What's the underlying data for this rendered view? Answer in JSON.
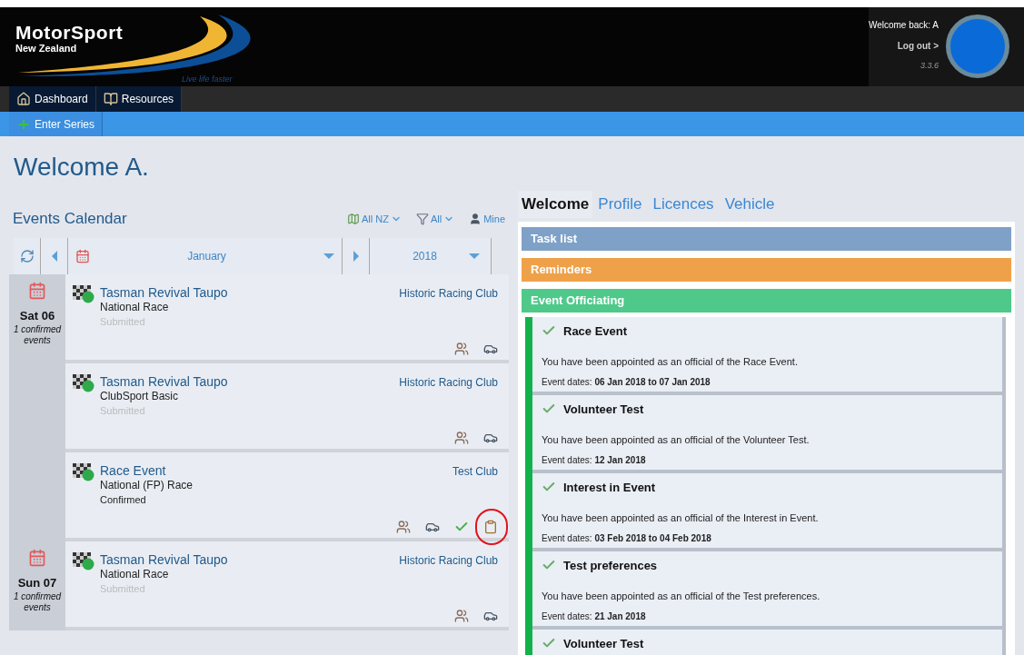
{
  "header": {
    "logo": {
      "title": "MotorSport",
      "subtitle": "New Zealand",
      "tagline": "Live life faster"
    },
    "welcome": "Welcome back: A",
    "logout": "Log out >",
    "version": "3.3.6"
  },
  "nav": [
    {
      "label": "Dashboard"
    },
    {
      "label": "Resources"
    }
  ],
  "subnav": [
    {
      "label": "Enter Series"
    }
  ],
  "page_title": "Welcome A.",
  "calendar": {
    "title": "Events Calendar",
    "filters": [
      {
        "label": "All NZ",
        "kind": "dropdown"
      },
      {
        "label": "All",
        "kind": "dropdown"
      },
      {
        "label": "Mine",
        "kind": "link"
      }
    ],
    "month": "January",
    "year": "2018",
    "days": [
      {
        "date": "Sat 06",
        "note": "1 confirmed events",
        "events": [
          {
            "name": "Tasman Revival Taupo",
            "type": "National Race",
            "club": "Historic Racing Club",
            "status": "Submitted",
            "confirmed": false,
            "highlighted": false
          },
          {
            "name": "Tasman Revival Taupo",
            "type": "ClubSport Basic",
            "club": "Historic Racing Club",
            "status": "Submitted",
            "confirmed": false,
            "highlighted": false
          },
          {
            "name": "Race Event",
            "type": "National (FP) Race",
            "club": "Test Club",
            "status": "Confirmed",
            "confirmed": true,
            "highlighted": true
          }
        ]
      },
      {
        "date": "Sun 07",
        "note": "1 confirmed events",
        "events": [
          {
            "name": "Tasman Revival Taupo",
            "type": "National Race",
            "club": "Historic Racing Club",
            "status": "Submitted",
            "confirmed": false,
            "highlighted": false
          }
        ]
      }
    ]
  },
  "tabs": [
    {
      "label": "Welcome",
      "selected": true
    },
    {
      "label": "Profile",
      "selected": false
    },
    {
      "label": "Licences",
      "selected": false
    },
    {
      "label": "Vehicle",
      "selected": false
    }
  ],
  "sections": [
    {
      "title": "Task list",
      "color": "#7fa1c7"
    },
    {
      "title": "Reminders",
      "color": "#efa14a"
    },
    {
      "title": "Event Officiating",
      "color": "#4fc98a"
    }
  ],
  "officiating": [
    {
      "title": "Race Event",
      "message": "You have been appointed as an official of the Race Event.",
      "dates": "Event dates: **06 Jan 2018 to 07 Jan 2018**"
    },
    {
      "title": "Volunteer Test",
      "message": "You have been appointed as an official of the Volunteer Test.",
      "dates": "Event dates: **12 Jan 2018**"
    },
    {
      "title": "Interest in Event",
      "message": "You have been appointed as an official of the Interest in Event.",
      "dates": "Event dates: **03 Feb 2018 to 04 Feb 2018**"
    },
    {
      "title": "Test preferences",
      "message": "You have been appointed as an official of the Test preferences.",
      "dates": "Event dates: **21 Jan 2018**"
    },
    {
      "title": "Volunteer Test"
    }
  ]
}
